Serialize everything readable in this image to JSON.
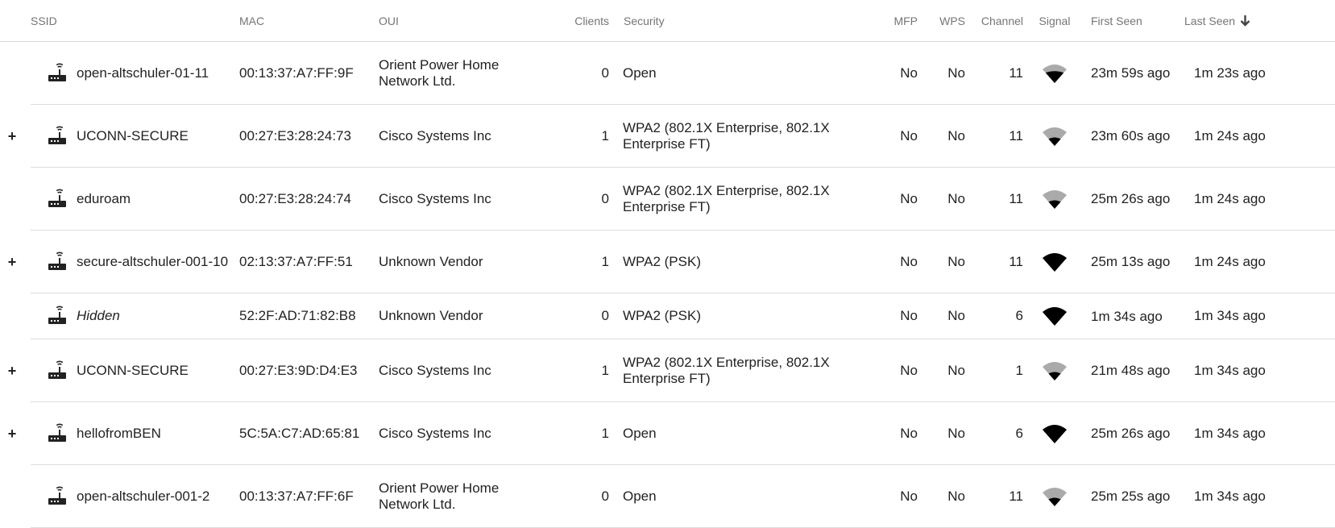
{
  "columns": {
    "ssid": "SSID",
    "mac": "MAC",
    "oui": "OUI",
    "clients": "Clients",
    "security": "Security",
    "mfp": "MFP",
    "wps": "WPS",
    "channel": "Channel",
    "signal": "Signal",
    "first_seen": "First Seen",
    "last_seen": "Last Seen"
  },
  "sort": {
    "column": "last_seen",
    "direction": "descending",
    "icon": "arrow-down-icon"
  },
  "colors": {
    "header_text": "#757575",
    "row_text": "#222222",
    "divider": "#dcdcdc",
    "signal_strong": "#000000",
    "signal_weak": "#aaaaaa"
  },
  "rows": [
    {
      "expand": "",
      "ssid": "open-altschuler-01-11",
      "mac": "00:13:37:A7:FF:9F",
      "oui": "Orient Power Home Network Ltd.",
      "clients": "0",
      "security": "Open",
      "mfp": "No",
      "wps": "No",
      "channel": "11",
      "signal_level": 0.75,
      "first_seen": "23m 59s ago",
      "last_seen": "1m 23s ago"
    },
    {
      "expand": "+",
      "ssid": "UCONN-SECURE",
      "mac": "00:27:E3:28:24:73",
      "oui": "Cisco Systems Inc",
      "clients": "1",
      "security": "WPA2 (802.1X Enterprise, 802.1X Enterprise FT)",
      "mfp": "No",
      "wps": "No",
      "channel": "11",
      "signal_level": 0.5,
      "first_seen": "23m 60s ago",
      "last_seen": "1m 24s ago"
    },
    {
      "expand": "",
      "ssid": "eduroam",
      "mac": "00:27:E3:28:24:74",
      "oui": "Cisco Systems Inc",
      "clients": "0",
      "security": "WPA2 (802.1X Enterprise, 802.1X Enterprise FT)",
      "mfp": "No",
      "wps": "No",
      "channel": "11",
      "signal_level": 0.5,
      "first_seen": "25m 26s ago",
      "last_seen": "1m 24s ago"
    },
    {
      "expand": "+",
      "ssid": "secure-altschuler-001-10",
      "mac": "02:13:37:A7:FF:51",
      "oui": "Unknown Vendor",
      "clients": "1",
      "security": "WPA2 (PSK)",
      "mfp": "No",
      "wps": "No",
      "channel": "11",
      "signal_level": 1,
      "first_seen": "25m 13s ago",
      "last_seen": "1m 24s ago"
    },
    {
      "expand": "",
      "ssid": "Hidden",
      "mac": "52:2F:AD:71:82:B8",
      "oui": "Unknown Vendor",
      "clients": "0",
      "security": "WPA2 (PSK)",
      "mfp": "No",
      "wps": "No",
      "channel": "6",
      "signal_level": 1,
      "first_seen": "1m 34s ago",
      "last_seen": "1m 34s ago"
    },
    {
      "expand": "+",
      "ssid": "UCONN-SECURE",
      "mac": "00:27:E3:9D:D4:E3",
      "oui": "Cisco Systems Inc",
      "clients": "1",
      "security": "WPA2 (802.1X Enterprise, 802.1X Enterprise FT)",
      "mfp": "No",
      "wps": "No",
      "channel": "1",
      "signal_level": 0.5,
      "first_seen": "21m 48s ago",
      "last_seen": "1m 34s ago"
    },
    {
      "expand": "+",
      "ssid": "hellofromBEN",
      "mac": "5C:5A:C7:AD:65:81",
      "oui": "Cisco Systems Inc",
      "clients": "1",
      "security": "Open",
      "mfp": "No",
      "wps": "No",
      "channel": "6",
      "signal_level": 1,
      "first_seen": "25m 26s ago",
      "last_seen": "1m 34s ago"
    },
    {
      "expand": "",
      "ssid": "open-altschuler-001-2",
      "mac": "00:13:37:A7:FF:6F",
      "oui": "Orient Power Home Network Ltd.",
      "clients": "0",
      "security": "Open",
      "mfp": "No",
      "wps": "No",
      "channel": "11",
      "signal_level": 0.5,
      "first_seen": "25m 25s ago",
      "last_seen": "1m 34s ago"
    }
  ]
}
